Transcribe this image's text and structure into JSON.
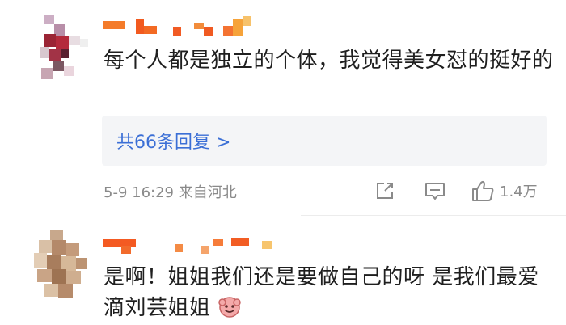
{
  "comments": [
    {
      "text": "每个人都是独立的个体，我觉得美女怼的挺好的",
      "replies_label": "共66条回复 >",
      "meta": "5-9 16:29 来自河北",
      "likes": "1.4万"
    },
    {
      "text": "是啊！姐姐我们还是要做自己的呀 是我们最爱滴刘芸姐姐"
    }
  ],
  "icons": {
    "share": "share-icon",
    "comment": "comment-icon",
    "like": "thumbs-up-icon",
    "emoji": "smiling-face-emoji-icon"
  },
  "colors": {
    "link": "#3b6fd6",
    "meta": "#8a8a8a",
    "text": "#1f1f1f",
    "reply_bg": "#f4f5f7"
  }
}
